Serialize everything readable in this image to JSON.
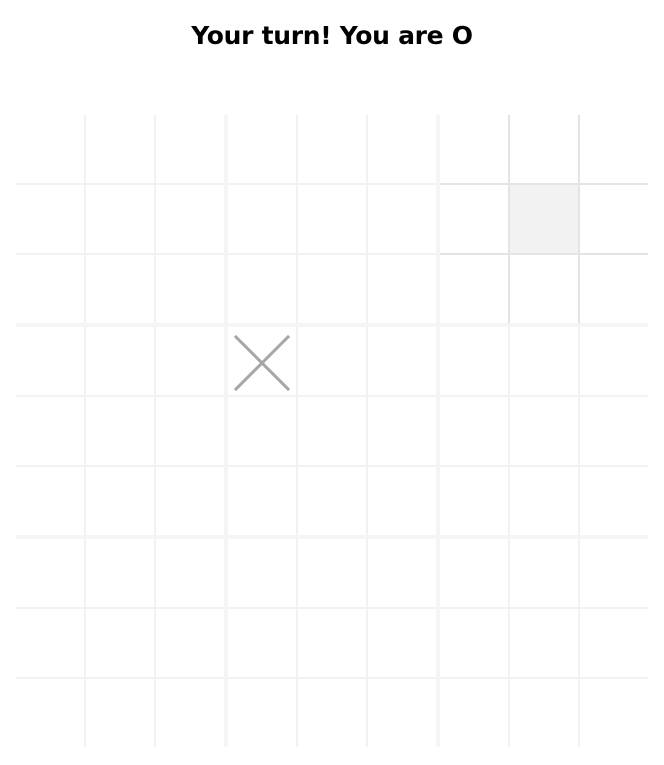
{
  "status_text": "Your turn! You are O",
  "board": {
    "active_sub_board": 2,
    "highlight": {
      "sub_board": 2,
      "cell": 4
    },
    "sub_boards": [
      [
        "",
        "",
        "",
        "",
        "",
        "",
        "",
        "",
        ""
      ],
      [
        "",
        "",
        "",
        "",
        "",
        "",
        "",
        "",
        ""
      ],
      [
        "",
        "",
        "",
        "",
        "",
        "",
        "",
        "",
        ""
      ],
      [
        "",
        "",
        "",
        "",
        "",
        "",
        "",
        "",
        ""
      ],
      [
        "X",
        "",
        "",
        "",
        "",
        "",
        "",
        "",
        ""
      ],
      [
        "",
        "",
        "",
        "",
        "",
        "",
        "",
        "",
        ""
      ],
      [
        "",
        "",
        "",
        "",
        "",
        "",
        "",
        "",
        ""
      ],
      [
        "",
        "",
        "",
        "",
        "",
        "",
        "",
        "",
        ""
      ],
      [
        "",
        "",
        "",
        "",
        "",
        "",
        "",
        "",
        ""
      ]
    ]
  },
  "colors": {
    "mark_x": "#a6a6a6",
    "active_grid": "#e4e4e4",
    "inactive_grid": "#f2f2f2",
    "highlight_cell": "#f2f2f3"
  }
}
